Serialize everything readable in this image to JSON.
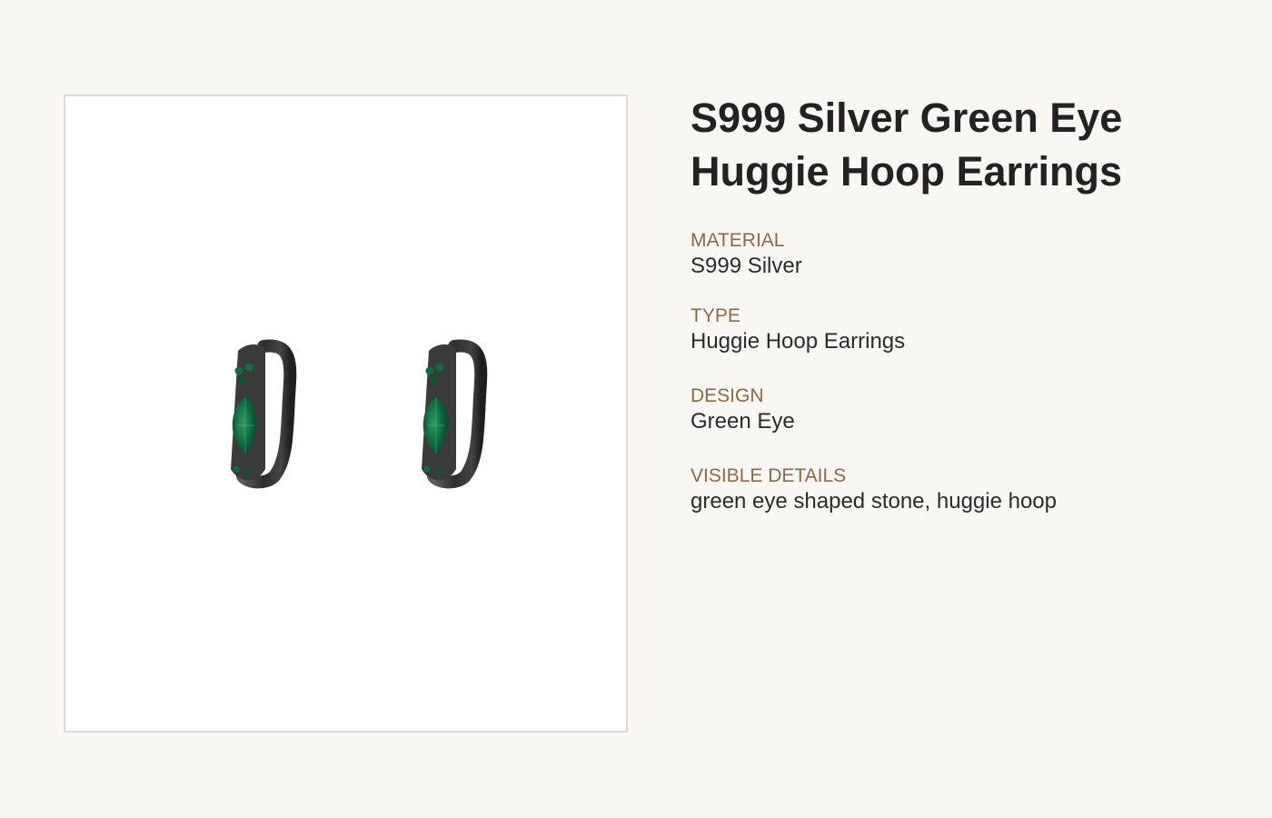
{
  "product": {
    "title": "S999 Silver Green Eye Huggie Hoop Earrings",
    "image_alt": "Black silver huggie hoop earrings with green marquise stone"
  },
  "attributes": [
    {
      "label": "MATERIAL",
      "value": "S999 Silver"
    },
    {
      "label": "TYPE",
      "value": "Huggie Hoop Earrings"
    },
    {
      "label": "DESIGN",
      "value": "Green Eye"
    },
    {
      "label": "VISIBLE DETAILS",
      "value": "green eye shaped stone, huggie hoop"
    }
  ],
  "colors": {
    "background": "#f8f7f4",
    "label_accent": "#8b6a47",
    "title_text": "#222222",
    "stone_green": "#0f6a3e",
    "metal_black": "#3a3a3a"
  }
}
